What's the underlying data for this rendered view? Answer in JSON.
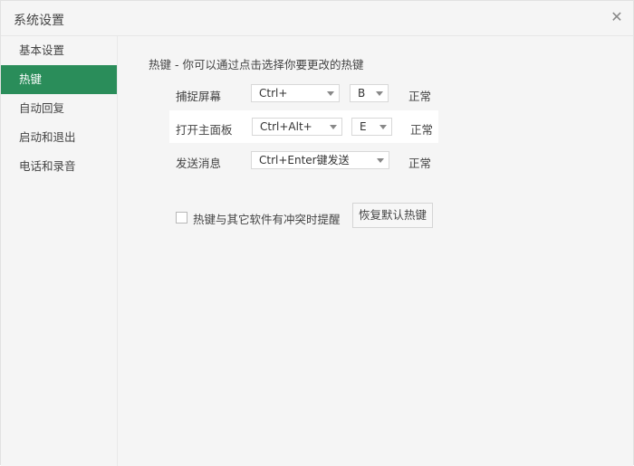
{
  "window": {
    "title": "系统设置",
    "close_icon": "close-icon"
  },
  "sidebar": {
    "items": [
      {
        "label": "基本设置",
        "active": false
      },
      {
        "label": "热键",
        "active": true
      },
      {
        "label": "自动回复",
        "active": false
      },
      {
        "label": "启动和退出",
        "active": false
      },
      {
        "label": "电话和录音",
        "active": false
      }
    ]
  },
  "hotkeys": {
    "header": "热键 - 你可以通过点击选择你要更改的热键",
    "rows": [
      {
        "label": "捕捉屏幕",
        "modifier": "Ctrl+",
        "key": "B",
        "status": "正常"
      },
      {
        "label": "打开主面板",
        "modifier": "Ctrl+Alt+",
        "key": "E",
        "status": "正常"
      },
      {
        "label": "发送消息",
        "modifier": "Ctrl+Enter键发送",
        "status": "正常"
      }
    ],
    "conflict_checkbox_label": "热键与其它软件有冲突时提醒",
    "conflict_checkbox_checked": false,
    "restore_button_label": "恢复默认热键"
  },
  "colors": {
    "accent": "#2a8d5a",
    "window_bg": "#f5f5f5",
    "highlight_bg": "#ffffff"
  }
}
